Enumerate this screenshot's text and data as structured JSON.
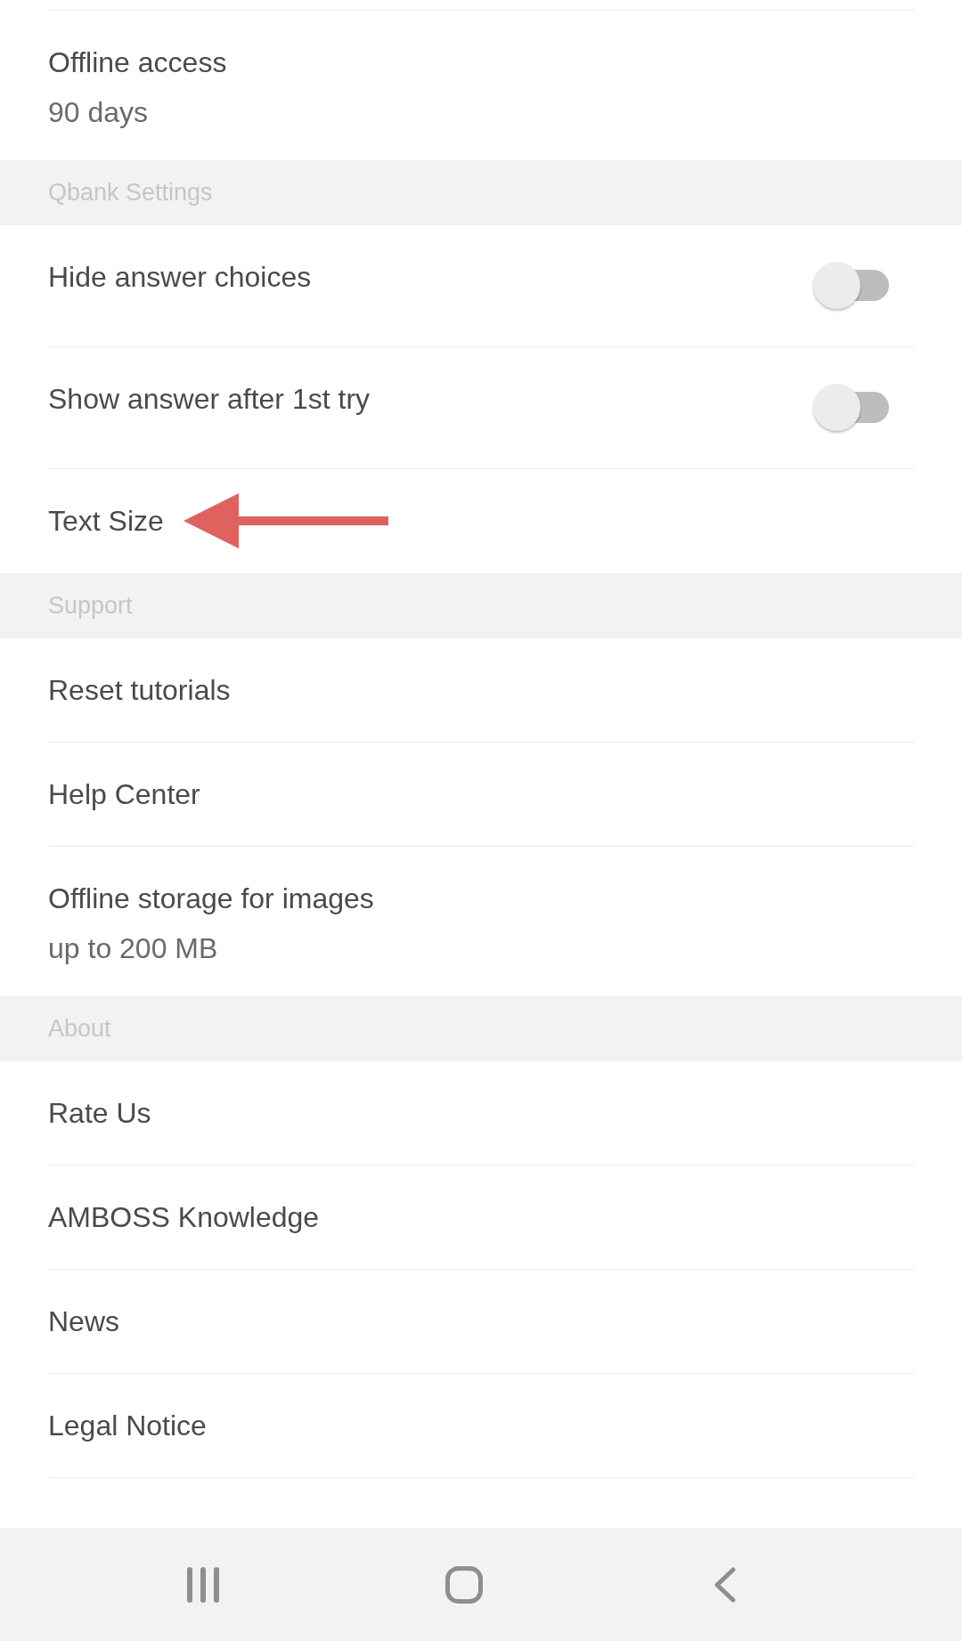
{
  "sections": [
    {
      "items": [
        {
          "kind": "detail",
          "title": "Offline access",
          "subtitle": "90 days"
        }
      ]
    },
    {
      "header": "Qbank Settings",
      "items": [
        {
          "kind": "toggle",
          "title": "Hide answer choices",
          "on": false
        },
        {
          "kind": "toggle",
          "title": "Show answer after 1st try",
          "on": false
        },
        {
          "kind": "plain",
          "title": "Text Size",
          "arrow": true
        }
      ]
    },
    {
      "header": "Support",
      "items": [
        {
          "kind": "plain",
          "title": "Reset tutorials"
        },
        {
          "kind": "plain",
          "title": "Help Center"
        },
        {
          "kind": "detail",
          "title": "Offline storage for images",
          "subtitle": "up to 200 MB"
        }
      ]
    },
    {
      "header": "About",
      "items": [
        {
          "kind": "plain",
          "title": "Rate Us"
        },
        {
          "kind": "plain",
          "title": "AMBOSS Knowledge"
        },
        {
          "kind": "plain",
          "title": "News"
        },
        {
          "kind": "plain",
          "title": "Legal Notice"
        }
      ]
    }
  ],
  "nav_bar": {
    "buttons": [
      {
        "kind": "recents"
      },
      {
        "kind": "home"
      },
      {
        "kind": "back"
      }
    ]
  }
}
